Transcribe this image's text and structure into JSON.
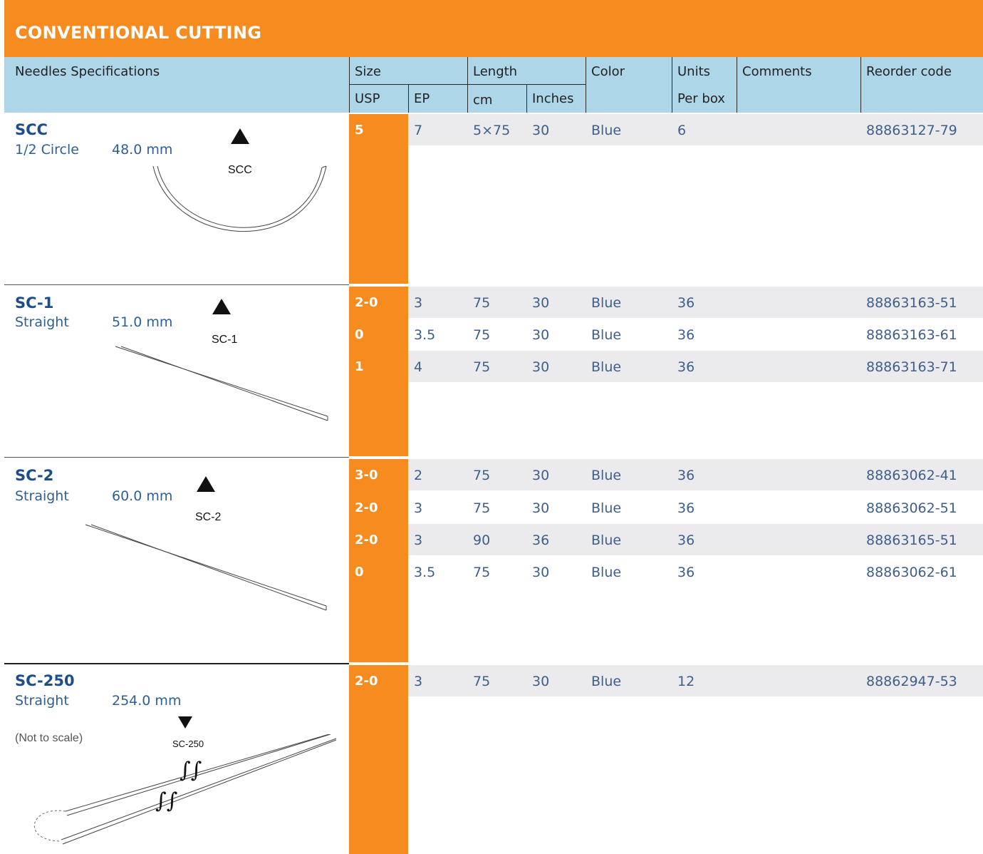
{
  "title": "CONVENTIONAL CUTTING",
  "headers": {
    "needles": "Needles Specifications",
    "size": "Size",
    "usp": "USP",
    "ep": "EP",
    "length": "Length",
    "cm": "cm",
    "inches": "Inches",
    "color": "Color",
    "units": "Units",
    "per_box": "Per box",
    "comments": "Comments",
    "reorder": "Reorder code"
  },
  "needles": [
    {
      "name": "SCC",
      "type": "1/2 Circle",
      "size": "48.0 mm",
      "label": "SCC"
    },
    {
      "name": "SC-1",
      "type": "Straight",
      "size": "51.0 mm",
      "label": "SC-1"
    },
    {
      "name": "SC-2",
      "type": "Straight",
      "size": "60.0 mm",
      "label": "SC-2"
    },
    {
      "name": "SC-250",
      "type": "Straight",
      "size": "254.0 mm",
      "label": "SC-250",
      "note": "(Not to scale)"
    }
  ],
  "rows": [
    {
      "usp": "5",
      "ep": "7",
      "cm": "5×75",
      "inches": "30",
      "color": "Blue",
      "units": "6",
      "comments": "",
      "code": "88863127-79"
    },
    {
      "usp": "2-0",
      "ep": "3",
      "cm": "75",
      "inches": "30",
      "color": "Blue",
      "units": "36",
      "comments": "",
      "code": "88863163-51"
    },
    {
      "usp": "0",
      "ep": "3.5",
      "cm": "75",
      "inches": "30",
      "color": "Blue",
      "units": "36",
      "comments": "",
      "code": "88863163-61"
    },
    {
      "usp": "1",
      "ep": "4",
      "cm": "75",
      "inches": "30",
      "color": "Blue",
      "units": "36",
      "comments": "",
      "code": "88863163-71"
    },
    {
      "usp": "3-0",
      "ep": "2",
      "cm": "75",
      "inches": "30",
      "color": "Blue",
      "units": "36",
      "comments": "",
      "code": "88863062-41"
    },
    {
      "usp": "2-0",
      "ep": "3",
      "cm": "75",
      "inches": "30",
      "color": "Blue",
      "units": "36",
      "comments": "",
      "code": "88863062-51"
    },
    {
      "usp": "2-0",
      "ep": "3",
      "cm": "90",
      "inches": "36",
      "color": "Blue",
      "units": "36",
      "comments": "",
      "code": "88863165-51"
    },
    {
      "usp": "0",
      "ep": "3.5",
      "cm": "75",
      "inches": "30",
      "color": "Blue",
      "units": "36",
      "comments": "",
      "code": "88863062-61"
    },
    {
      "usp": "2-0",
      "ep": "3",
      "cm": "75",
      "inches": "30",
      "color": "Blue",
      "units": "12",
      "comments": "",
      "code": "88862947-53"
    }
  ],
  "colors": {
    "accent": "#f68b1f",
    "header": "#aed6e9",
    "shade": "#ebebed",
    "text": "#1a4f8b"
  }
}
